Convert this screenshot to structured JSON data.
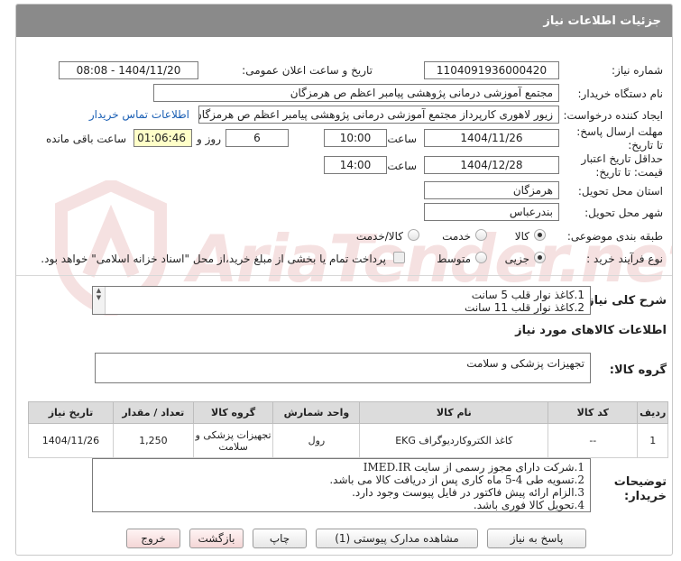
{
  "page": {
    "title": "جزئیات اطلاعات نیاز",
    "watermark": "AriaTender.net"
  },
  "form": {
    "need_number_label": "شماره نیاز:",
    "need_number": "1104091936000420",
    "announce_label": "تاریخ و ساعت اعلان عمومی:",
    "announce_value": "1404/11/20 - 08:08",
    "buyer_org_label": "نام دستگاه خریدار:",
    "buyer_org": "مجتمع آموزشی درمانی پژوهشی پیامبر اعظم ص  هرمزگان",
    "requester_label": "ایجاد کننده درخواست:",
    "requester": "زیور لاهوری کارپرداز مجتمع آموزشی درمانی پژوهشی پیامبر اعظم ص  هرمزگان",
    "contact_link": "اطلاعات تماس خریدار",
    "reply_deadline_label": "مهلت ارسال پاسخ: تا تاریخ:",
    "reply_date": "1404/11/26",
    "time_label": "ساعت",
    "reply_time": "10:00",
    "days": "6",
    "days_label": "روز و",
    "countdown": "01:06:46",
    "remaining_label": "ساعت باقی مانده",
    "validity_label": "حداقل تاریخ اعتبار قیمت: تا تاریخ:",
    "validity_date": "1404/12/28",
    "validity_time": "14:00",
    "province_label": "استان محل تحویل:",
    "province": "هرمزگان",
    "city_label": "شهر محل تحویل:",
    "city": "بندرعباس",
    "category_label": "طبقه بندی موضوعی:",
    "category_options": [
      "کالا",
      "خدمت",
      "کالا/خدمت"
    ],
    "process_label": "نوع فرآیند خرید :",
    "process_options": [
      "جزیی",
      "متوسط"
    ],
    "payment_note": "پرداخت تمام یا بخشی از مبلغ خرید،از محل \"اسناد خزانه اسلامی\" خواهد بود."
  },
  "description": {
    "label": "شرح کلی نیاز:",
    "lines": [
      "1.کاغذ نوار قلب 5 سانت",
      "2.کاغذ نوار قلب 11 سانت"
    ]
  },
  "goods": {
    "section_title": "اطلاعات کالاهای مورد نیاز",
    "group_label": "گروه کالا:",
    "group_value": "تجهیزات پزشکی و سلامت",
    "columns": [
      "ردیف",
      "کد کالا",
      "نام کالا",
      "واحد شمارش",
      "گروه کالا",
      "تعداد / مقدار",
      "تاریخ نیاز"
    ],
    "rows": [
      {
        "row": "1",
        "code": "--",
        "name": "کاغذ الکتروکاردیوگراف EKG",
        "unit": "رول",
        "group": "تجهیزات پزشکی و سلامت",
        "qty": "1,250",
        "date": "1404/11/26"
      }
    ]
  },
  "buyer_notes": {
    "label": "توضیحات خریدار:",
    "lines": [
      "1.شرکت دارای مجوز رسمی از سایت IMED.IR",
      "2.تسویه طی 4-5 ماه  کاری پس از دریافت کالا می باشد.",
      "3.الزام ارائه پیش فاکتور در فایل پیوست وجود دارد.",
      "4.تحویل کالا فوری باشد."
    ]
  },
  "buttons": {
    "reply": "پاسخ به نیاز",
    "attachments": "مشاهده مدارک پیوستی (1)",
    "print": "چاپ",
    "back": "بازگشت",
    "exit": "خروج"
  }
}
